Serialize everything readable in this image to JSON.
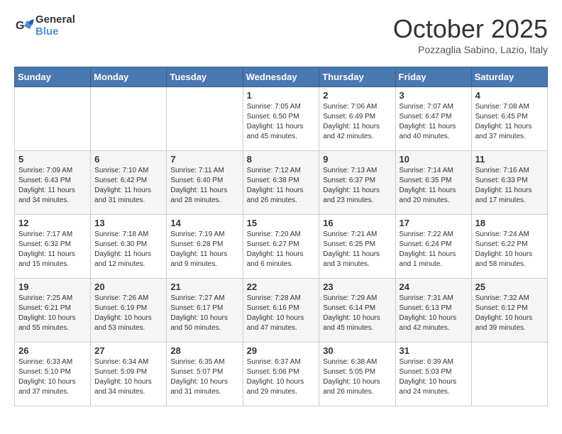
{
  "header": {
    "logo_line1": "General",
    "logo_line2": "Blue",
    "month": "October 2025",
    "location": "Pozzaglia Sabino, Lazio, Italy"
  },
  "weekdays": [
    "Sunday",
    "Monday",
    "Tuesday",
    "Wednesday",
    "Thursday",
    "Friday",
    "Saturday"
  ],
  "weeks": [
    [
      {
        "day": "",
        "info": ""
      },
      {
        "day": "",
        "info": ""
      },
      {
        "day": "",
        "info": ""
      },
      {
        "day": "1",
        "info": "Sunrise: 7:05 AM\nSunset: 6:50 PM\nDaylight: 11 hours\nand 45 minutes."
      },
      {
        "day": "2",
        "info": "Sunrise: 7:06 AM\nSunset: 6:49 PM\nDaylight: 11 hours\nand 42 minutes."
      },
      {
        "day": "3",
        "info": "Sunrise: 7:07 AM\nSunset: 6:47 PM\nDaylight: 11 hours\nand 40 minutes."
      },
      {
        "day": "4",
        "info": "Sunrise: 7:08 AM\nSunset: 6:45 PM\nDaylight: 11 hours\nand 37 minutes."
      }
    ],
    [
      {
        "day": "5",
        "info": "Sunrise: 7:09 AM\nSunset: 6:43 PM\nDaylight: 11 hours\nand 34 minutes."
      },
      {
        "day": "6",
        "info": "Sunrise: 7:10 AM\nSunset: 6:42 PM\nDaylight: 11 hours\nand 31 minutes."
      },
      {
        "day": "7",
        "info": "Sunrise: 7:11 AM\nSunset: 6:40 PM\nDaylight: 11 hours\nand 28 minutes."
      },
      {
        "day": "8",
        "info": "Sunrise: 7:12 AM\nSunset: 6:38 PM\nDaylight: 11 hours\nand 26 minutes."
      },
      {
        "day": "9",
        "info": "Sunrise: 7:13 AM\nSunset: 6:37 PM\nDaylight: 11 hours\nand 23 minutes."
      },
      {
        "day": "10",
        "info": "Sunrise: 7:14 AM\nSunset: 6:35 PM\nDaylight: 11 hours\nand 20 minutes."
      },
      {
        "day": "11",
        "info": "Sunrise: 7:16 AM\nSunset: 6:33 PM\nDaylight: 11 hours\nand 17 minutes."
      }
    ],
    [
      {
        "day": "12",
        "info": "Sunrise: 7:17 AM\nSunset: 6:32 PM\nDaylight: 11 hours\nand 15 minutes."
      },
      {
        "day": "13",
        "info": "Sunrise: 7:18 AM\nSunset: 6:30 PM\nDaylight: 11 hours\nand 12 minutes."
      },
      {
        "day": "14",
        "info": "Sunrise: 7:19 AM\nSunset: 6:28 PM\nDaylight: 11 hours\nand 9 minutes."
      },
      {
        "day": "15",
        "info": "Sunrise: 7:20 AM\nSunset: 6:27 PM\nDaylight: 11 hours\nand 6 minutes."
      },
      {
        "day": "16",
        "info": "Sunrise: 7:21 AM\nSunset: 6:25 PM\nDaylight: 11 hours\nand 3 minutes."
      },
      {
        "day": "17",
        "info": "Sunrise: 7:22 AM\nSunset: 6:24 PM\nDaylight: 11 hours\nand 1 minute."
      },
      {
        "day": "18",
        "info": "Sunrise: 7:24 AM\nSunset: 6:22 PM\nDaylight: 10 hours\nand 58 minutes."
      }
    ],
    [
      {
        "day": "19",
        "info": "Sunrise: 7:25 AM\nSunset: 6:21 PM\nDaylight: 10 hours\nand 55 minutes."
      },
      {
        "day": "20",
        "info": "Sunrise: 7:26 AM\nSunset: 6:19 PM\nDaylight: 10 hours\nand 53 minutes."
      },
      {
        "day": "21",
        "info": "Sunrise: 7:27 AM\nSunset: 6:17 PM\nDaylight: 10 hours\nand 50 minutes."
      },
      {
        "day": "22",
        "info": "Sunrise: 7:28 AM\nSunset: 6:16 PM\nDaylight: 10 hours\nand 47 minutes."
      },
      {
        "day": "23",
        "info": "Sunrise: 7:29 AM\nSunset: 6:14 PM\nDaylight: 10 hours\nand 45 minutes."
      },
      {
        "day": "24",
        "info": "Sunrise: 7:31 AM\nSunset: 6:13 PM\nDaylight: 10 hours\nand 42 minutes."
      },
      {
        "day": "25",
        "info": "Sunrise: 7:32 AM\nSunset: 6:12 PM\nDaylight: 10 hours\nand 39 minutes."
      }
    ],
    [
      {
        "day": "26",
        "info": "Sunrise: 6:33 AM\nSunset: 5:10 PM\nDaylight: 10 hours\nand 37 minutes."
      },
      {
        "day": "27",
        "info": "Sunrise: 6:34 AM\nSunset: 5:09 PM\nDaylight: 10 hours\nand 34 minutes."
      },
      {
        "day": "28",
        "info": "Sunrise: 6:35 AM\nSunset: 5:07 PM\nDaylight: 10 hours\nand 31 minutes."
      },
      {
        "day": "29",
        "info": "Sunrise: 6:37 AM\nSunset: 5:06 PM\nDaylight: 10 hours\nand 29 minutes."
      },
      {
        "day": "30",
        "info": "Sunrise: 6:38 AM\nSunset: 5:05 PM\nDaylight: 10 hours\nand 26 minutes."
      },
      {
        "day": "31",
        "info": "Sunrise: 6:39 AM\nSunset: 5:03 PM\nDaylight: 10 hours\nand 24 minutes."
      },
      {
        "day": "",
        "info": ""
      }
    ]
  ]
}
